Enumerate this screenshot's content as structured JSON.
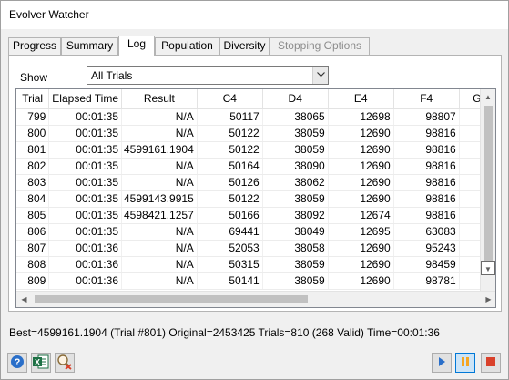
{
  "window": {
    "title": "Evolver Watcher"
  },
  "tabs": [
    {
      "label": "Progress",
      "state": "normal"
    },
    {
      "label": "Summary",
      "state": "normal"
    },
    {
      "label": "Log",
      "state": "active"
    },
    {
      "label": "Population",
      "state": "normal"
    },
    {
      "label": "Diversity",
      "state": "normal"
    },
    {
      "label": "Stopping Options",
      "state": "disabled"
    }
  ],
  "filter": {
    "label": "Show",
    "value": "All Trials"
  },
  "table": {
    "columns": [
      "Trial",
      "Elapsed Time",
      "Result",
      "C4",
      "D4",
      "E4",
      "F4",
      "G"
    ],
    "rows": [
      [
        "799",
        "00:01:35",
        "N/A",
        "50117",
        "38065",
        "12698",
        "98807",
        ""
      ],
      [
        "800",
        "00:01:35",
        "N/A",
        "50122",
        "38059",
        "12690",
        "98816",
        ""
      ],
      [
        "801",
        "00:01:35",
        "4599161.1904",
        "50122",
        "38059",
        "12690",
        "98816",
        ""
      ],
      [
        "802",
        "00:01:35",
        "N/A",
        "50164",
        "38090",
        "12690",
        "98816",
        ""
      ],
      [
        "803",
        "00:01:35",
        "N/A",
        "50126",
        "38062",
        "12690",
        "98816",
        ""
      ],
      [
        "804",
        "00:01:35",
        "4599143.9915",
        "50122",
        "38059",
        "12690",
        "98816",
        ""
      ],
      [
        "805",
        "00:01:35",
        "4598421.1257",
        "50166",
        "38092",
        "12674",
        "98816",
        ""
      ],
      [
        "806",
        "00:01:35",
        "N/A",
        "69441",
        "38049",
        "12695",
        "63083",
        ""
      ],
      [
        "807",
        "00:01:36",
        "N/A",
        "52053",
        "38058",
        "12690",
        "95243",
        ""
      ],
      [
        "808",
        "00:01:36",
        "N/A",
        "50315",
        "38059",
        "12690",
        "98459",
        ""
      ],
      [
        "809",
        "00:01:36",
        "N/A",
        "50141",
        "38059",
        "12690",
        "98781",
        ""
      ]
    ]
  },
  "status": {
    "text": "Best=4599161.1904 (Trial #801) Original=2453425 Trials=810 (268 Valid) Time=00:01:36"
  },
  "toolbar": {
    "help_icon": "help-icon",
    "excel_icon": "excel-icon",
    "log_icon": "magnifier-cancel-icon",
    "run_icon": "play-icon",
    "pause_icon": "pause-icon",
    "stop_icon": "stop-icon",
    "colors": {
      "pause": "#f5a623",
      "stop": "#d9412b",
      "play": "#2a6fc9",
      "excel": "#1e7145"
    }
  }
}
